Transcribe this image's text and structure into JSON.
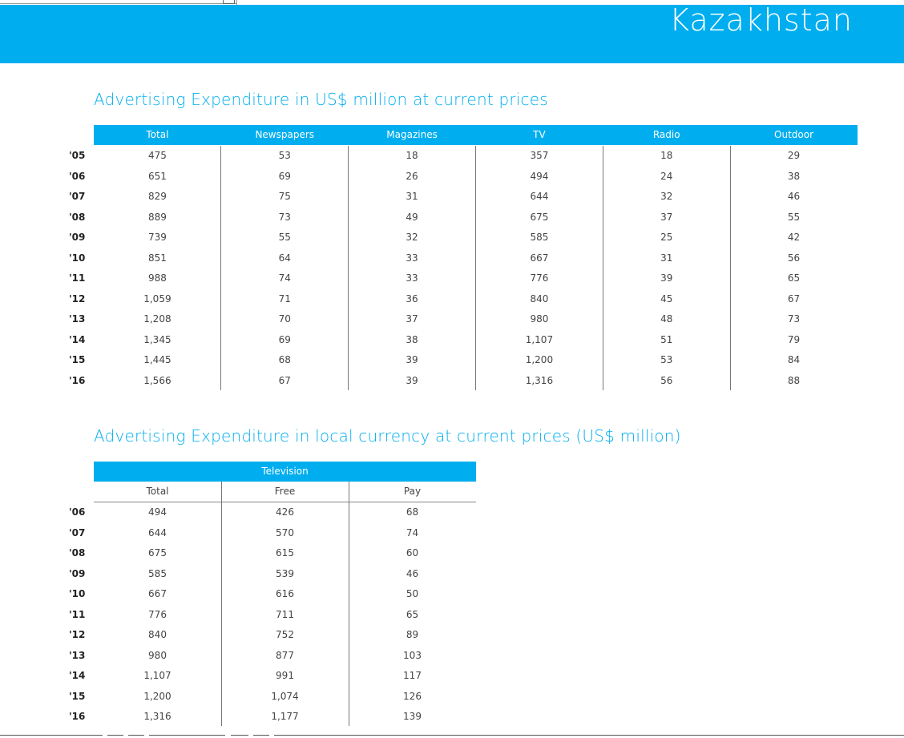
{
  "banner": {
    "title": "Kazakhstan"
  },
  "table1": {
    "title": "Advertising Expenditure in US$ million at current prices",
    "columns": [
      "Total",
      "Newspapers",
      "Magazines",
      "TV",
      "Radio",
      "Outdoor"
    ],
    "rows": [
      {
        "year": "'05",
        "values": [
          "475",
          "53",
          "18",
          "357",
          "18",
          "29"
        ]
      },
      {
        "year": "'06",
        "values": [
          "651",
          "69",
          "26",
          "494",
          "24",
          "38"
        ]
      },
      {
        "year": "'07",
        "values": [
          "829",
          "75",
          "31",
          "644",
          "32",
          "46"
        ]
      },
      {
        "year": "'08",
        "values": [
          "889",
          "73",
          "49",
          "675",
          "37",
          "55"
        ]
      },
      {
        "year": "'09",
        "values": [
          "739",
          "55",
          "32",
          "585",
          "25",
          "42"
        ]
      },
      {
        "year": "'10",
        "values": [
          "851",
          "64",
          "33",
          "667",
          "31",
          "56"
        ]
      },
      {
        "year": "'11",
        "values": [
          "988",
          "74",
          "33",
          "776",
          "39",
          "65"
        ]
      },
      {
        "year": "'12",
        "values": [
          "1,059",
          "71",
          "36",
          "840",
          "45",
          "67"
        ]
      },
      {
        "year": "'13",
        "values": [
          "1,208",
          "70",
          "37",
          "980",
          "48",
          "73"
        ]
      },
      {
        "year": "'14",
        "values": [
          "1,345",
          "69",
          "38",
          "1,107",
          "51",
          "79"
        ]
      },
      {
        "year": "'15",
        "values": [
          "1,445",
          "68",
          "39",
          "1,200",
          "53",
          "84"
        ]
      },
      {
        "year": "'16",
        "values": [
          "1,566",
          "67",
          "39",
          "1,316",
          "56",
          "88"
        ]
      }
    ]
  },
  "table2": {
    "title": "Advertising Expenditure in local currency at current prices (US$ million)",
    "group_header": "Television",
    "columns": [
      "Total",
      "Free",
      "Pay"
    ],
    "rows": [
      {
        "year": "'06",
        "values": [
          "494",
          "426",
          "68"
        ]
      },
      {
        "year": "'07",
        "values": [
          "644",
          "570",
          "74"
        ]
      },
      {
        "year": "'08",
        "values": [
          "675",
          "615",
          "60"
        ]
      },
      {
        "year": "'09",
        "values": [
          "585",
          "539",
          "46"
        ]
      },
      {
        "year": "'10",
        "values": [
          "667",
          "616",
          "50"
        ]
      },
      {
        "year": "'11",
        "values": [
          "776",
          "711",
          "65"
        ]
      },
      {
        "year": "'12",
        "values": [
          "840",
          "752",
          "89"
        ]
      },
      {
        "year": "'13",
        "values": [
          "980",
          "877",
          "103"
        ]
      },
      {
        "year": "'14",
        "values": [
          "1,107",
          "991",
          "117"
        ]
      },
      {
        "year": "'15",
        "values": [
          "1,200",
          "1,074",
          "126"
        ]
      },
      {
        "year": "'16",
        "values": [
          "1,316",
          "1,177",
          "139"
        ]
      }
    ]
  }
}
